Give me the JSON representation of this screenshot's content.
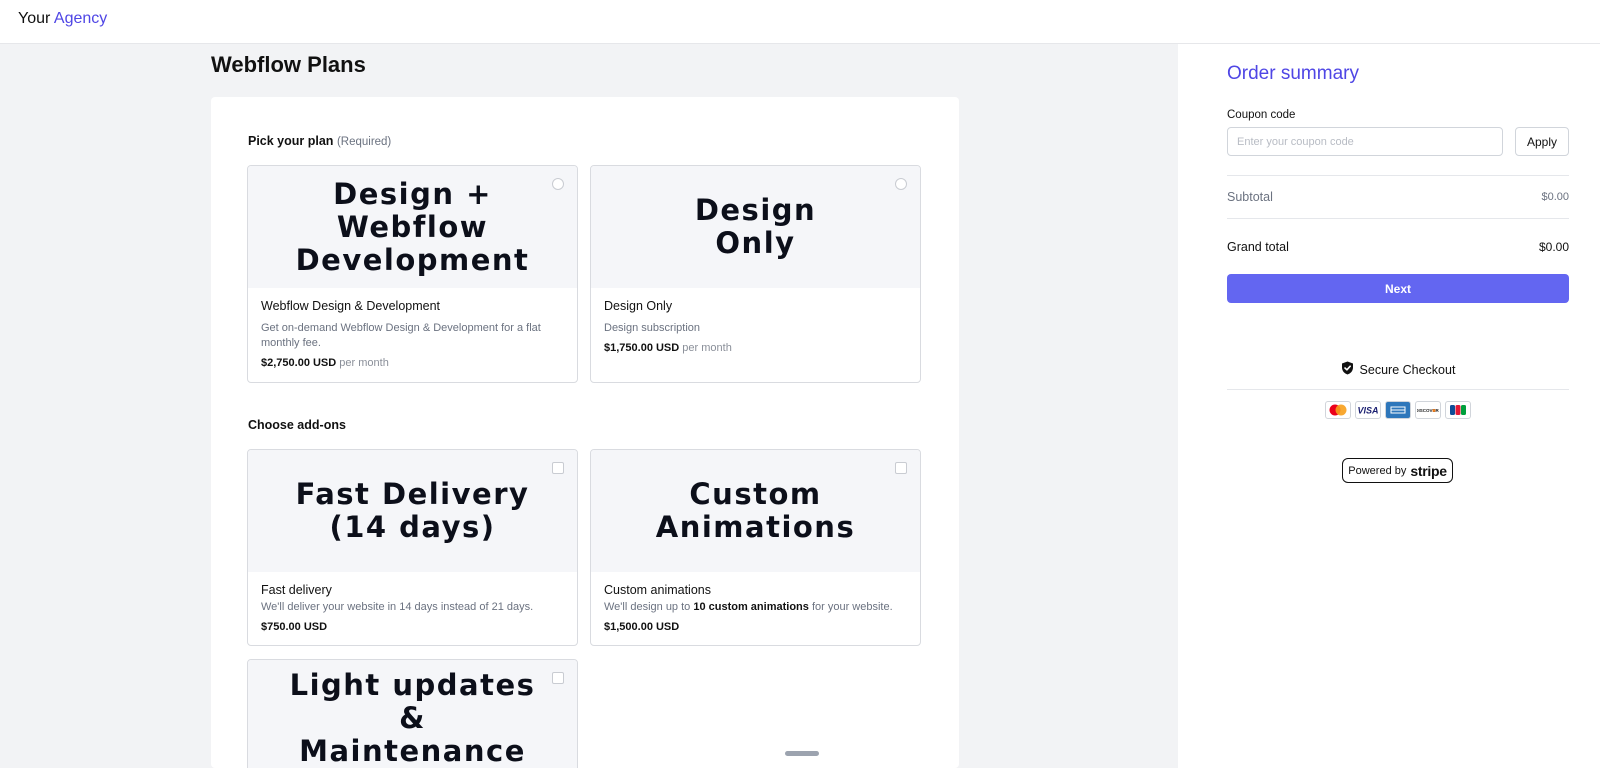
{
  "header": {
    "logo_part1": "Your",
    "logo_part2": "Agency"
  },
  "page": {
    "title": "Webflow Plans"
  },
  "plans_section": {
    "label": "Pick your plan",
    "required": "(Required)"
  },
  "plans": [
    {
      "banner": "Design +\nWebflow\nDevelopment",
      "name": "Webflow Design & Development",
      "description": "Get on-demand Webflow Design & Development for a flat monthly fee.",
      "price": "$2,750.00 USD",
      "period": "per month"
    },
    {
      "banner": "Design\nOnly",
      "name": "Design Only",
      "description": "Design subscription",
      "price": "$1,750.00 USD",
      "period": "per month"
    }
  ],
  "addons_section": {
    "label": "Choose add-ons"
  },
  "addons": [
    {
      "banner": "Fast Delivery\n(14 days)",
      "name": "Fast delivery",
      "description": "We'll deliver your website in 14 days instead of 21 days.",
      "price": "$750.00 USD"
    },
    {
      "banner": "Custom\nAnimations",
      "name": "Custom animations",
      "description_pre": "We'll design up to ",
      "description_bold": "10 custom animations",
      "description_post": " for your website.",
      "price": "$1,500.00 USD"
    },
    {
      "banner": "Light updates\n&\nMaintenance"
    }
  ],
  "summary": {
    "title": "Order summary",
    "coupon_label": "Coupon code",
    "coupon_placeholder": "Enter your coupon code",
    "apply_label": "Apply",
    "subtotal_label": "Subtotal",
    "subtotal_value": "$0.00",
    "grand_total_label": "Grand total",
    "grand_total_value": "$0.00",
    "next_label": "Next",
    "secure_label": "Secure Checkout",
    "payment_icons": [
      "mastercard-icon",
      "visa-icon",
      "amex-icon",
      "discover-icon",
      "jcb-icon"
    ],
    "powered_by": "Powered by",
    "powered_brand": "stripe"
  },
  "colors": {
    "accent": "#4f46e5",
    "button": "#6366f1"
  }
}
